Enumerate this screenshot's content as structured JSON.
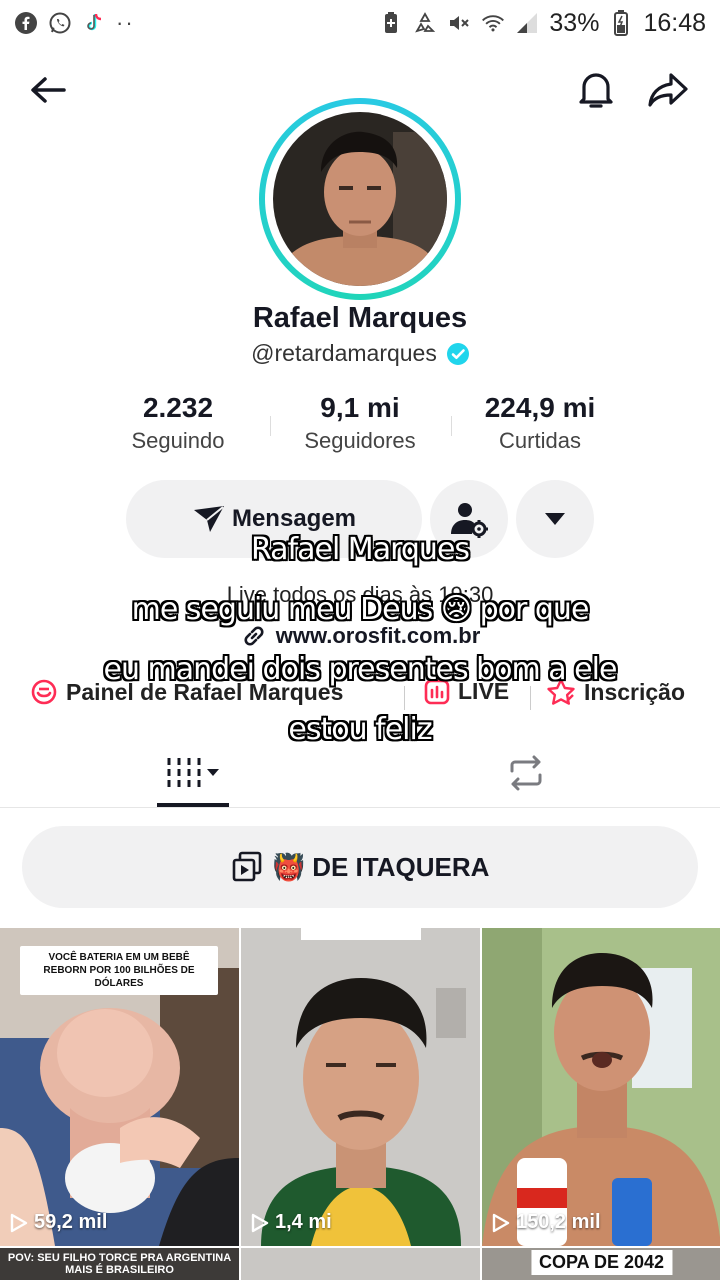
{
  "status_bar": {
    "battery_percent": "33%",
    "time": "16:48",
    "dots": "··",
    "left_icons": [
      "facebook-icon",
      "whatsapp-icon",
      "tiktok-icon"
    ],
    "right_icons": [
      "battery-saver-icon",
      "recycle-icon",
      "mute-icon",
      "wifi-icon",
      "signal-icon",
      "battery-icon"
    ]
  },
  "nav": {
    "back_icon": "arrow-left-icon",
    "bell_icon": "bell-icon",
    "share_icon": "share-arrow-icon"
  },
  "profile": {
    "name": "Rafael Marques",
    "handle": "@retardamarques",
    "verified": true,
    "stats": [
      {
        "value": "2.232",
        "label": "Seguindo"
      },
      {
        "value": "9,1 mi",
        "label": "Seguidores"
      },
      {
        "value": "224,9 mi",
        "label": "Curtidas"
      }
    ],
    "message_button": "Mensagem",
    "bio": "Live todos os dias às 19:30",
    "link": "www.orosfit.com.br"
  },
  "features": [
    {
      "label": "Painel de Rafael Marques",
      "icon": "panel-icon"
    },
    {
      "label": "LIVE",
      "icon": "live-chart-icon"
    },
    {
      "label": "Inscrição",
      "icon": "subscription-star-icon"
    }
  ],
  "captions": [
    "Rafael Marques",
    "me seguiu meu Deus 😢 por que",
    "eu mandei dois presentes bom a ele",
    "estou feliz"
  ],
  "tabs": {
    "videos_icon": "grid-videos-icon",
    "reposts_icon": "repost-icon"
  },
  "playlist": {
    "label": "👹 DE ITAQUERA"
  },
  "videos": [
    {
      "views": "59,2 mil",
      "caption": "VOCÊ BATERIA EM UM BEBÊ REBORN POR 100 BILHÕES DE DÓLARES"
    },
    {
      "views": "1,4 mi",
      "caption": ""
    },
    {
      "views": "150,2 mil",
      "caption": ""
    }
  ],
  "next_row": [
    {
      "caption": "POV: SEU FILHO TORCE PRA ARGENTINA MAIS É BRASILEIRO"
    },
    {
      "caption": ""
    },
    {
      "caption": "COPA DE 2042"
    }
  ],
  "colors": {
    "accent_ring": "#29c9e5",
    "verified": "#20d5ec",
    "live_icon": "#fe2c55"
  }
}
